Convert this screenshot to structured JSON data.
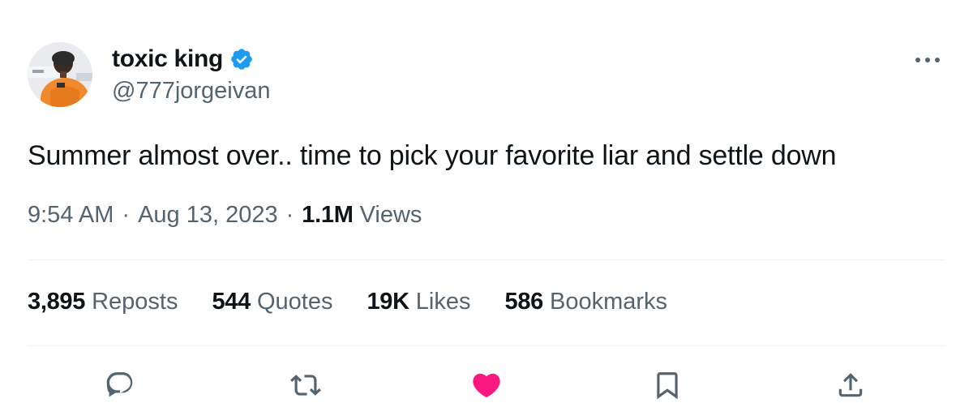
{
  "author": {
    "display_name": "toxic king",
    "handle": "@777jorgeivan",
    "verified": true
  },
  "tweet": {
    "text": "Summer almost over.. time to pick your favorite liar and settle down",
    "time": "9:54 AM",
    "date": "Aug 13, 2023",
    "separator": "·",
    "views_count": "1.1M",
    "views_label": "Views"
  },
  "stats": [
    {
      "count": "3,895",
      "label": "Reposts"
    },
    {
      "count": "544",
      "label": "Quotes"
    },
    {
      "count": "19K",
      "label": "Likes"
    },
    {
      "count": "586",
      "label": "Bookmarks"
    }
  ],
  "actions": [
    {
      "name": "reply",
      "icon": "reply-icon"
    },
    {
      "name": "repost",
      "icon": "repost-icon"
    },
    {
      "name": "like",
      "icon": "heart-filled-icon",
      "active": true
    },
    {
      "name": "bookmark",
      "icon": "bookmark-icon"
    },
    {
      "name": "share",
      "icon": "share-icon"
    }
  ],
  "colors": {
    "verified": "#1d9bf0",
    "like_active": "#f91880",
    "secondary_text": "#536471",
    "primary_text": "#0f1419",
    "divider": "#eff3f4"
  }
}
